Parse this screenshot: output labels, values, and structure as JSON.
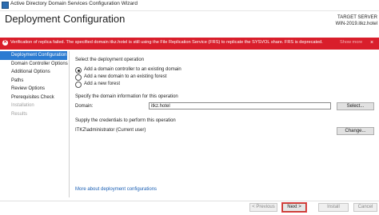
{
  "window": {
    "title": "Active Directory Domain Services Configuration Wizard",
    "icon": "ad-wizard-icon"
  },
  "header": {
    "page_title": "Deployment Configuration",
    "target_label": "TARGET SERVER",
    "target_server": "WIN-2019.itkz.hotel"
  },
  "banner": {
    "message": "Verification of replica failed. The specified domain itkz.hotel is still using the File Replication Service (FRS) to replicate the SYSVOL share. FRS is deprecated.",
    "show_more": "Show more",
    "close": "×",
    "color": "#d91e2b"
  },
  "nav": {
    "items": [
      {
        "label": "Deployment Configuration",
        "state": "active"
      },
      {
        "label": "Domain Controller Options",
        "state": "normal"
      },
      {
        "label": "Additional Options",
        "state": "normal"
      },
      {
        "label": "Paths",
        "state": "normal"
      },
      {
        "label": "Review Options",
        "state": "normal"
      },
      {
        "label": "Prerequisites Check",
        "state": "normal"
      },
      {
        "label": "Installation",
        "state": "disabled"
      },
      {
        "label": "Results",
        "state": "disabled"
      }
    ]
  },
  "main": {
    "operation_heading": "Select the deployment operation",
    "options": [
      {
        "label": "Add a domain controller to an existing domain",
        "checked": true
      },
      {
        "label": "Add a new domain to an existing forest",
        "checked": false
      },
      {
        "label": "Add a new forest",
        "checked": false
      }
    ],
    "domain_heading": "Specify the domain information for this operation",
    "domain_label": "Domain:",
    "domain_value": "itkz.hotel",
    "select_button": "Select...",
    "credentials_heading": "Supply the credentials to perform this operation",
    "credentials_value": "ITKZ\\administrator (Current user)",
    "change_button": "Change...",
    "more_link": "More about deployment configurations"
  },
  "footer": {
    "previous": "< Previous",
    "next": "Next >",
    "install": "Install",
    "cancel": "Cancel"
  }
}
